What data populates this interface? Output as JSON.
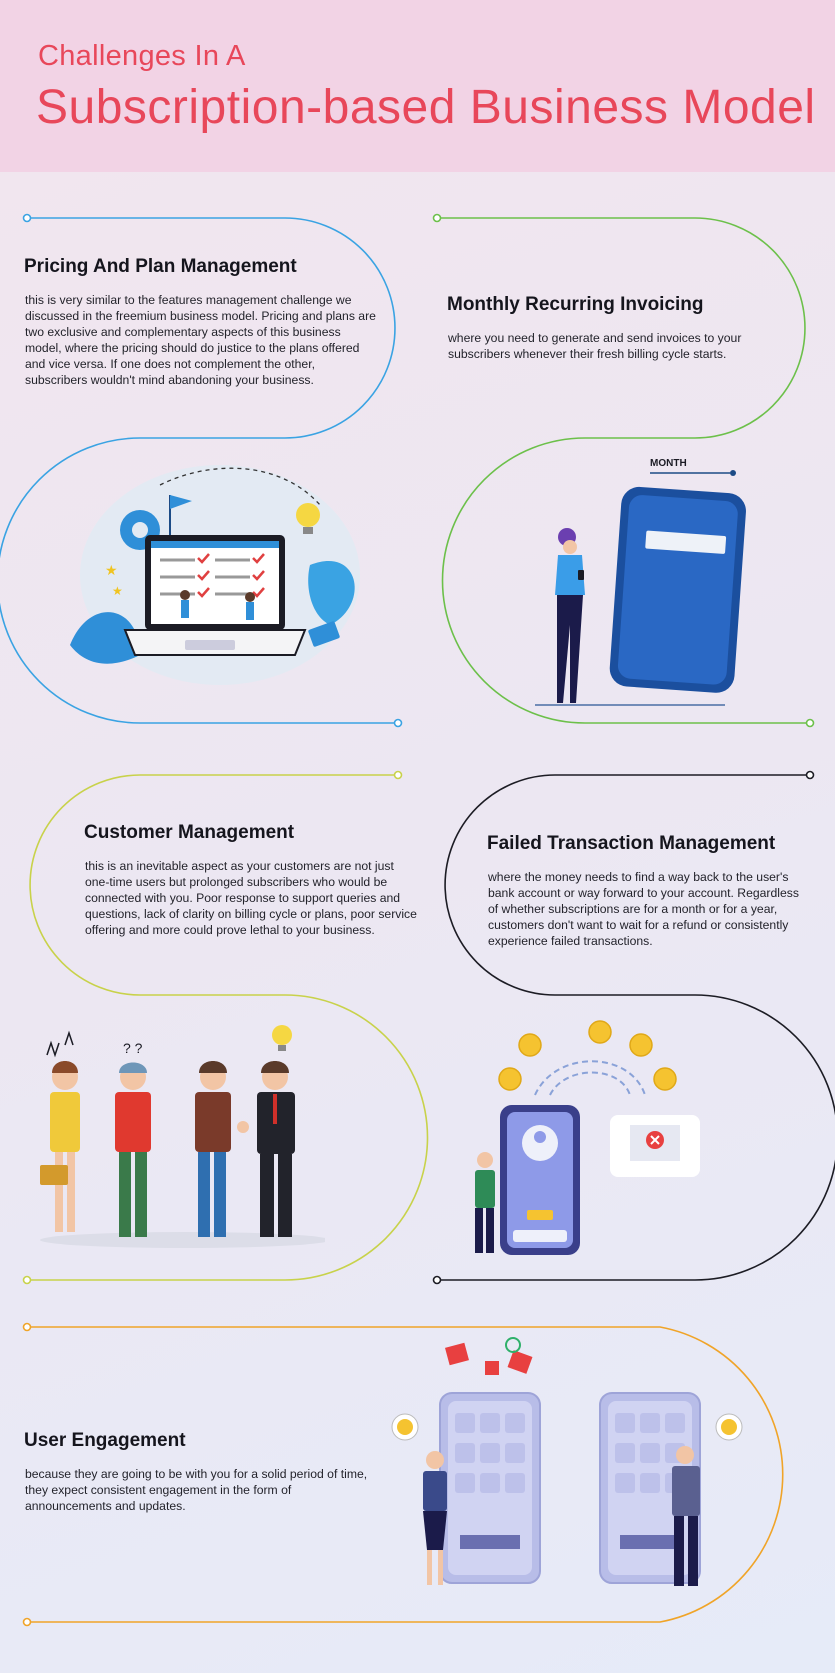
{
  "header": {
    "title_small": "Challenges In A",
    "title_big": "Subscription-based Business Model"
  },
  "sections": [
    {
      "title": "Pricing And Plan Management",
      "body": "this is very similar to the features management challenge we discussed in the freemium business model. Pricing and plans are two exclusive and complementary aspects of this business model, where the pricing should do justice to the plans offered and vice versa. If one does not complement the other, subscribers wouldn't mind abandoning your business.",
      "color": "#3aa3e3"
    },
    {
      "title": "Monthly Recurring Invoicing",
      "body": "where you need to generate and send invoices to your subscribers whenever their fresh billing cycle starts.",
      "color": "#6cc04a",
      "illustration_label": "MONTH"
    },
    {
      "title": "Customer Management",
      "body": "this is an inevitable aspect as your customers are not just one-time users but prolonged subscribers who would be connected with you. Poor response to support queries and questions, lack of clarity on billing cycle or plans, poor service offering and more could prove lethal to your business.",
      "color": "#c8d24a",
      "illustration_label": "? ?"
    },
    {
      "title": "Failed Transaction Management",
      "body": "where the money needs to find a way back to the user's bank account or way forward to your account. Regardless of whether subscriptions are for a month or for a year, customers don't want to wait for a refund or consistently experience failed transactions.",
      "color": "#1c1c24"
    },
    {
      "title": "User Engagement",
      "body": "because they are going to be with you for a solid period of time, they expect consistent engagement in the form of announcements and updates.",
      "color": "#f0a428"
    }
  ],
  "icons": [
    "laptop-checklist-illustration",
    "phone-month-illustration",
    "customers-illustration",
    "failed-transaction-illustration",
    "engagement-illustration"
  ]
}
